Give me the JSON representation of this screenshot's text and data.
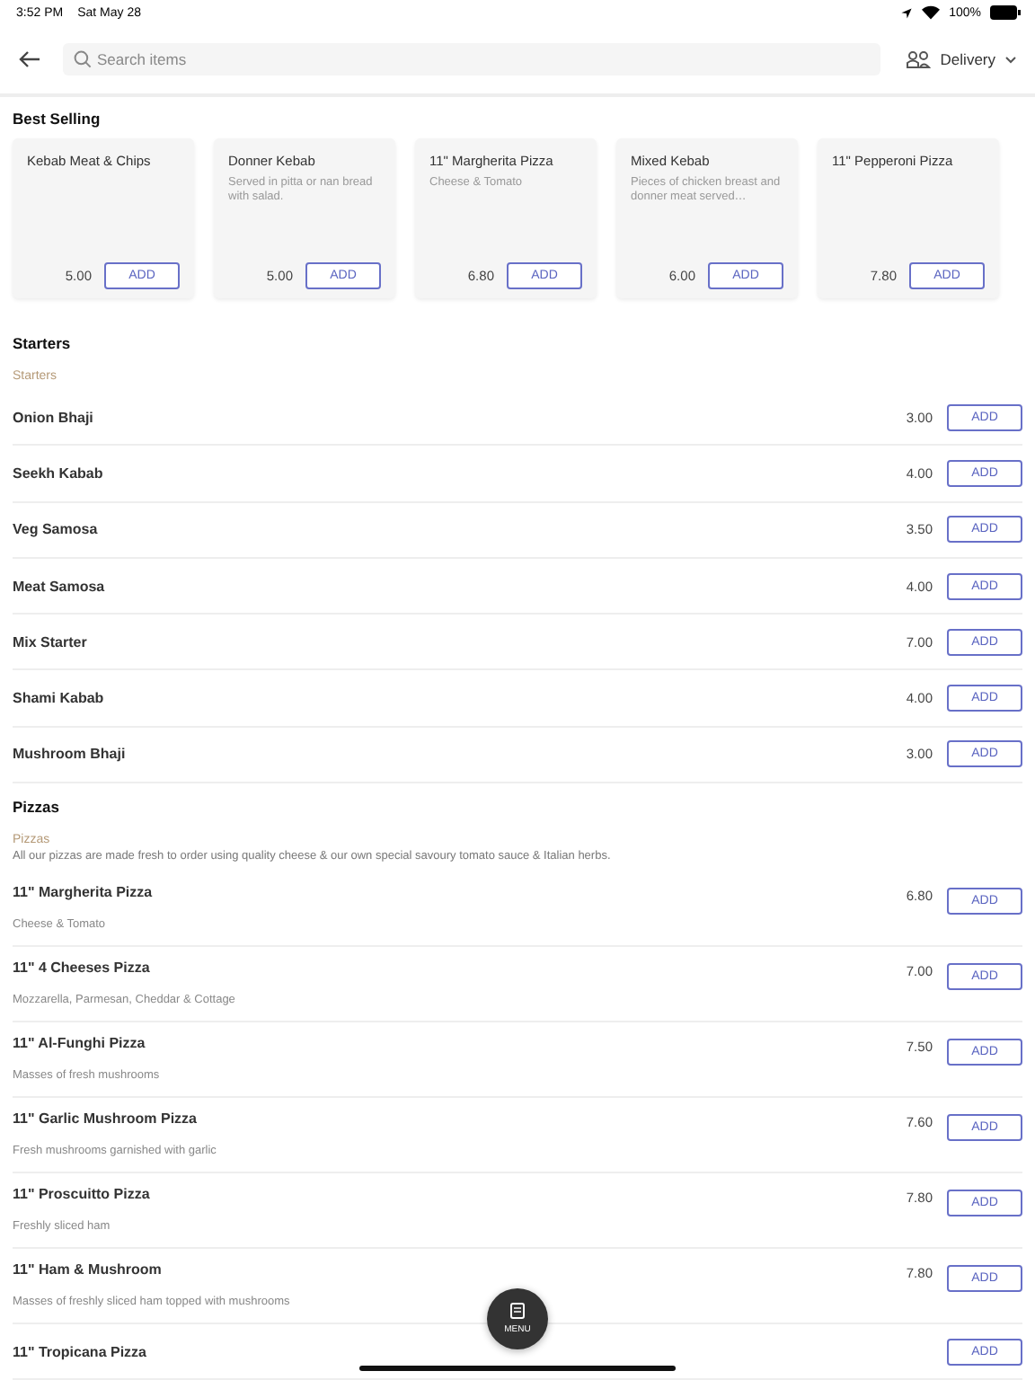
{
  "status_bar": {
    "time": "3:52 PM",
    "date": "Sat May 28",
    "battery": "100%"
  },
  "header": {
    "search": {
      "placeholder": "Search items"
    },
    "delivery": "Delivery"
  },
  "best_selling": {
    "title": "Best Selling",
    "items": [
      {
        "name": "Kebab Meat & Chips",
        "price": "5.00",
        "button": "ADD"
      },
      {
        "name": "Donner Kebab",
        "description": "Served in pitta or nan bread with salad.",
        "price": "5.00",
        "button": "ADD"
      },
      {
        "name": "11\" Margherita Pizza",
        "description": "Cheese & Tomato",
        "price": "6.80",
        "button": "ADD"
      },
      {
        "name": "Mixed Kebab",
        "description": "Pieces of chicken breast and donner meat served…",
        "price": "6.00",
        "button": "ADD"
      },
      {
        "name": "11\" Pepperoni Pizza",
        "price": "7.80",
        "button": "ADD"
      }
    ]
  },
  "sections": [
    {
      "title": "Starters",
      "subtitle": "Starters",
      "items": [
        {
          "name": "Onion Bhaji",
          "price": "3.00",
          "button": "ADD"
        },
        {
          "name": "Seekh Kabab",
          "price": "4.00",
          "button": "ADD"
        },
        {
          "name": "Veg Samosa",
          "price": "3.50",
          "button": "ADD"
        },
        {
          "name": "Meat Samosa",
          "price": "4.00",
          "button": "ADD"
        },
        {
          "name": "Mix Starter",
          "price": "7.00",
          "button": "ADD"
        },
        {
          "name": "Shami Kabab",
          "price": "4.00",
          "button": "ADD"
        },
        {
          "name": "Mushroom Bhaji",
          "price": "3.00",
          "button": "ADD"
        }
      ]
    },
    {
      "title": "Pizzas",
      "subtitle": "Pizzas",
      "description": "All our pizzas are made fresh to order using quality cheese & our own special savoury tomato sauce & Italian herbs.",
      "items": [
        {
          "name": "11\" Margherita Pizza",
          "description": "Cheese & Tomato",
          "price": "6.80",
          "button": "ADD"
        },
        {
          "name": "11\" 4 Cheeses Pizza",
          "description": "Mozzarella, Parmesan, Cheddar & Cottage",
          "price": "7.00",
          "button": "ADD"
        },
        {
          "name": "11\" Al-Funghi Pizza",
          "description": "Masses of fresh mushrooms",
          "price": "7.50",
          "button": "ADD"
        },
        {
          "name": "11\" Garlic Mushroom Pizza",
          "description": "Fresh mushrooms garnished with garlic",
          "price": "7.60",
          "button": "ADD"
        },
        {
          "name": "11\" Proscuitto Pizza",
          "description": "Freshly sliced ham",
          "price": "7.80",
          "button": "ADD"
        },
        {
          "name": "11\" Ham & Mushroom",
          "description": "Masses of freshly sliced ham topped with mushrooms",
          "price": "7.80",
          "button": "ADD"
        },
        {
          "name": "11\" Tropicana Pizza",
          "button": "ADD"
        }
      ]
    }
  ],
  "menu_button": "MENU"
}
